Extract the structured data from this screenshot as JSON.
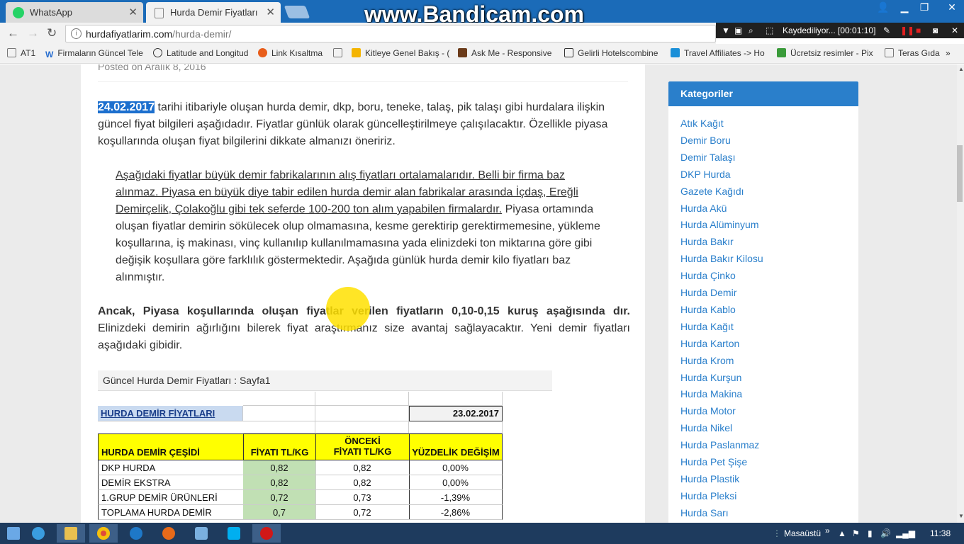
{
  "browser": {
    "tabs": [
      {
        "title": "WhatsApp",
        "active": false
      },
      {
        "title": "Hurda Demir Fiyatları |Gü",
        "active": true
      }
    ],
    "watermark": "www.Bandicam.com",
    "url_host": "hurdafiyatlarim.com",
    "url_path": "/hurda-demir/",
    "recording": "Kaydediliyor... [00:01:10]",
    "bookmarks": [
      "AT1",
      "Firmaların Güncel Tele",
      "Latitude and Longitud",
      "Link Kısaltma",
      "Kitleye Genel Bakış - (",
      "Ask Me - Responsive",
      "Gelirli Hotelscombine",
      "Travel Affiliates -> Ho",
      "Ücretsiz resimler - Pix",
      "Teras Gıda"
    ],
    "bookmarks_more": "»"
  },
  "post": {
    "posted_on": "Posted on Aralık 8, 2016",
    "date_highlight": "24.02.2017",
    "intro_rest": " tarihi itibariyle oluşan hurda demir, dkp, boru, teneke, talaş, pik talaşı gibi hurdalara ilişkin güncel fiyat bilgileri aşağıdadır. Fiyatlar günlük olarak güncelleştirilmeye çalışılacaktır. Özellikle piyasa koşullarında oluşan fiyat bilgilerini dikkate almanızı öneririz.",
    "quote_underlined": "Aşağıdaki fiyatlar büyük demir fabrikalarının alış fiyatları ortalamalarıdır. Belli bir firma baz alınmaz. Piyasa en büyük diye tabir edilen hurda demir alan fabrikalar arasında İçdaş, Ereğli Demirçelik, Çolakoğlu gibi tek seferde 100-200 ton alım yapabilen firmalardır.",
    "quote_rest": " Piyasa ortamında oluşan fiyatlar demirin sökülecek olup olmamasına, kesme gerektirip gerektirmemesine, yükleme koşullarına, iş makinası, vinç kullanılıp kullanılmamasına yada elinizdeki ton miktarına göre gibi değişik koşullara göre farklılık göstermektedir. Aşağıda günlük hurda demir kilo fiyatları baz alınmıştır.",
    "bold_line": "Ancak, Piyasa koşullarında oluşan fiyatlar verilen fiyatların 0,10-0,15 kuruş aşağısında dır.",
    "after_bold": "Elinizdeki demirin ağırlığını bilerek fiyat araştırmanız size avantaj sağlayacaktır. Yeni demir fiyatları aşağıdaki gibidir."
  },
  "sheet": {
    "header": "Güncel Hurda Demir Fiyatları : Sayfa1",
    "title": "HURDA DEMİR FİYATLARI",
    "date": "23.02.2017",
    "columns": [
      "HURDA DEMİR ÇEŞİDİ",
      "FİYATI TL/KG",
      "ÖNCEKİ FİYATI TL/KG",
      "YÜZDELİK DEĞİŞİM"
    ],
    "rows": [
      [
        "DKP HURDA",
        "0,82",
        "0,82",
        "0,00%"
      ],
      [
        "DEMİR EKSTRA",
        "0,82",
        "0,82",
        "0,00%"
      ],
      [
        "1.GRUP DEMİR ÜRÜNLERİ",
        "0,72",
        "0,73",
        "-1,39%"
      ],
      [
        "TOPLAMA HURDA DEMİR",
        "0,7",
        "0,72",
        "-2,86%"
      ]
    ]
  },
  "sidebar": {
    "heading": "Kategoriler",
    "categories": [
      "Atık Kağıt",
      "Demir Boru",
      "Demir Talaşı",
      "DKP Hurda",
      "Gazete Kağıdı",
      "Hurda Akü",
      "Hurda Alüminyum",
      "Hurda Bakır",
      "Hurda Bakır Kilosu",
      "Hurda Çinko",
      "Hurda Demir",
      "Hurda Kablo",
      "Hurda Kağıt",
      "Hurda Karton",
      "Hurda Krom",
      "Hurda Kurşun",
      "Hurda Makina",
      "Hurda Motor",
      "Hurda Nikel",
      "Hurda Paslanmaz",
      "Hurda Pet Şişe",
      "Hurda Plastik",
      "Hurda Pleksi",
      "Hurda Sarı"
    ]
  },
  "taskbar": {
    "desktop_label": "Masaüstü",
    "desktop_chevron": "»",
    "time": "11:38"
  },
  "colors": {
    "accent": "#2a7fcb",
    "title_bar": "#1b6bb8",
    "highlight_yellow": "#ffff00",
    "price_green": "#c1e0b4"
  }
}
